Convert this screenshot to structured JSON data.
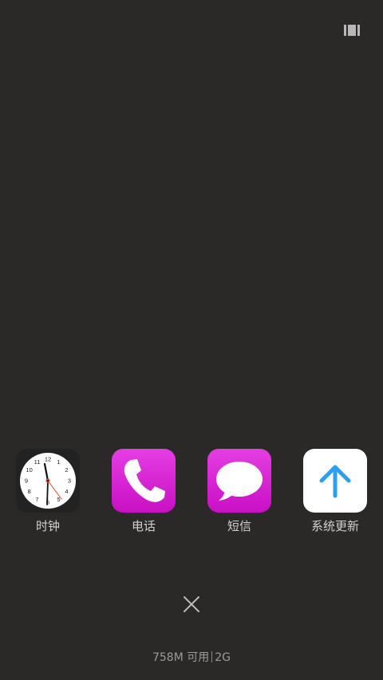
{
  "top_bar": {
    "view_toggle_icon": "view-mode-toggle-icon"
  },
  "apps": [
    {
      "label": "时钟",
      "icon": "clock-icon",
      "background": "#222222"
    },
    {
      "label": "电话",
      "icon": "phone-icon",
      "background": "#d414d0"
    },
    {
      "label": "短信",
      "icon": "messages-icon",
      "background": "#d414d0"
    },
    {
      "label": "系统更新",
      "icon": "system-update-icon",
      "background": "#ffffff",
      "accent": "#2c9ff0"
    }
  ],
  "clock": {
    "numbers": [
      "12",
      "1",
      "2",
      "3",
      "4",
      "5",
      "6",
      "7",
      "8",
      "9",
      "10",
      "11"
    ]
  },
  "close": {
    "icon": "close-icon"
  },
  "memory": {
    "available": "758M 可用",
    "total": "2G"
  },
  "colors": {
    "background": "#2b2828",
    "label": "#d2d0d0",
    "memory_text": "#9d9a9a",
    "magenta": "#d414d0",
    "update_arrow": "#2c9ff0",
    "clock_second_hand": "#e0472a"
  }
}
